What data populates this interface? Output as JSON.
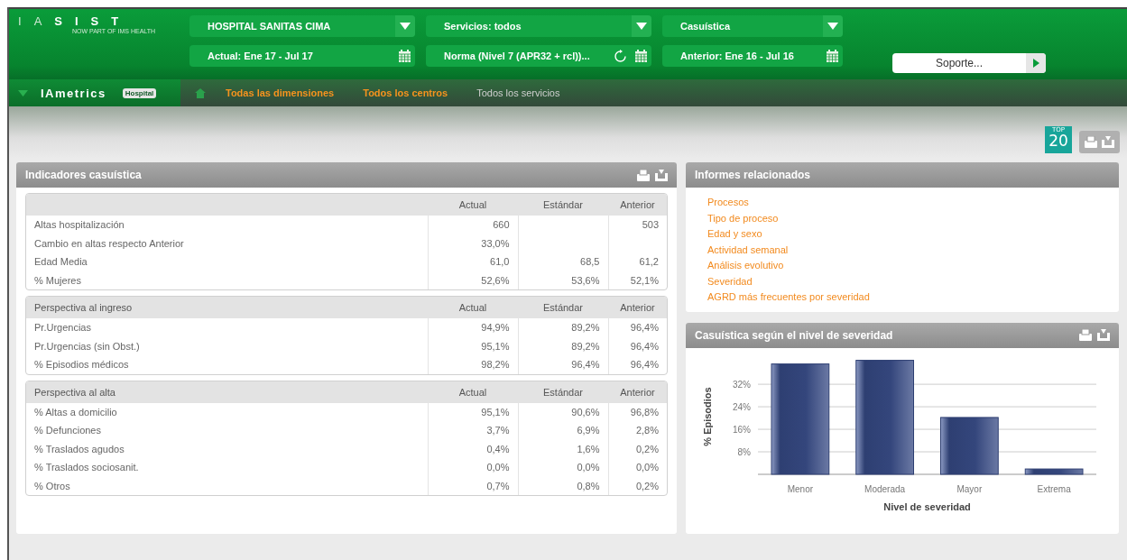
{
  "logo": {
    "letters": [
      "I",
      "A",
      "S",
      "I",
      "S",
      "T"
    ],
    "tagline": "NOW PART OF IMS HEALTH"
  },
  "selectors": [
    {
      "label": "HOSPITAL SANITAS CIMA",
      "kind": "dropdown"
    },
    {
      "label": "Servicios: todos",
      "kind": "dropdown"
    },
    {
      "label": "Casuística",
      "kind": "dropdown"
    },
    {
      "label": "Actual: Ene 17 - Jul 17",
      "kind": "calendar"
    },
    {
      "label": "Norma (Nivel 7 (APR32 + rcl))...",
      "kind": "refresh_calendar"
    },
    {
      "label": "Anterior: Ene 16 - Jul 16",
      "kind": "calendar"
    }
  ],
  "support": {
    "label": "Soporte..."
  },
  "app": {
    "name": "IAmetrics",
    "badge": "Hospital"
  },
  "breadcrumbs": [
    {
      "label": "Todas las dimensiones",
      "link": true
    },
    {
      "label": "Todos los centros",
      "link": true
    },
    {
      "label": "Todos los servicios",
      "link": false
    }
  ],
  "top_badge": {
    "top": "TOP",
    "number": "20"
  },
  "indicators": {
    "title": "Indicadores casuística",
    "sections": [
      {
        "columns": [
          "",
          "Actual",
          "Estándar",
          "Anterior"
        ],
        "rows": [
          [
            "Altas hospitalización",
            "660",
            "",
            "503"
          ],
          [
            "Cambio en altas respecto Anterior",
            "33,0%",
            "",
            ""
          ],
          [
            "Edad Media",
            "61,0",
            "68,5",
            "61,2"
          ],
          [
            "% Mujeres",
            "52,6%",
            "53,6%",
            "52,1%"
          ]
        ]
      },
      {
        "columns": [
          "Perspectiva al ingreso",
          "Actual",
          "Estándar",
          "Anterior"
        ],
        "rows": [
          [
            "Pr.Urgencias",
            "94,9%",
            "89,2%",
            "96,4%"
          ],
          [
            "Pr.Urgencias (sin Obst.)",
            "95,1%",
            "89,2%",
            "96,4%"
          ],
          [
            "% Episodios médicos",
            "98,2%",
            "96,4%",
            "96,4%"
          ]
        ]
      },
      {
        "columns": [
          "Perspectiva al alta",
          "Actual",
          "Estándar",
          "Anterior"
        ],
        "rows": [
          [
            "% Altas a domicilio",
            "95,1%",
            "90,6%",
            "96,8%"
          ],
          [
            "% Defunciones",
            "3,7%",
            "6,9%",
            "2,8%"
          ],
          [
            "% Traslados agudos",
            "0,4%",
            "1,6%",
            "0,2%"
          ],
          [
            "% Traslados sociosanit.",
            "0,0%",
            "0,0%",
            "0,0%"
          ],
          [
            "% Otros",
            "0,7%",
            "0,8%",
            "0,2%"
          ]
        ]
      }
    ]
  },
  "reports": {
    "title": "Informes relacionados",
    "links": [
      "Procesos",
      "Tipo de proceso",
      "Edad y sexo",
      "Actividad semanal",
      "Análisis evolutivo",
      "Severidad",
      "AGRD más frecuentes por severidad"
    ]
  },
  "severity": {
    "title": "Casuística según el nivel de severidad",
    "chart_data": {
      "type": "bar",
      "xlabel": "Nivel de severidad",
      "ylabel": "% Episodios",
      "categories": [
        "Menor",
        "Moderada",
        "Mayor",
        "Extrema"
      ],
      "values": [
        39.2,
        40.5,
        20.2,
        1.9
      ],
      "grid": true,
      "ylim": [
        0,
        41
      ],
      "yticks": [
        {
          "value": 8,
          "label": "8%"
        },
        {
          "value": 16,
          "label": "16%"
        },
        {
          "value": 24,
          "label": "24%"
        },
        {
          "value": 32,
          "label": "32%"
        }
      ]
    }
  }
}
